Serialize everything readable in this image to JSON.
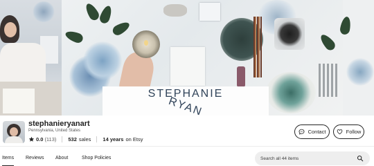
{
  "banner": {
    "brand_line1": "STEPHANIE",
    "brand_line2": "RYAN"
  },
  "shop": {
    "name": "stephanieryanart",
    "location": "Pennsylvania, United States",
    "rating": "0.0",
    "review_count": "(113)",
    "sales_count": "532",
    "sales_label": "sales",
    "years": "14 years",
    "years_suffix": "on Etsy"
  },
  "actions": {
    "contact_label": "Contact",
    "follow_label": "Follow"
  },
  "tabs": [
    {
      "label": "Items"
    },
    {
      "label": "Reviews"
    },
    {
      "label": "About"
    },
    {
      "label": "Shop Policies"
    }
  ],
  "search": {
    "placeholder": "Search all 44 items"
  },
  "colors": {
    "brand_text": "#2f4258",
    "star": "#222222",
    "search_bg": "#eeeeee"
  },
  "icons": [
    "star-icon",
    "chat-icon",
    "heart-icon",
    "search-icon"
  ]
}
